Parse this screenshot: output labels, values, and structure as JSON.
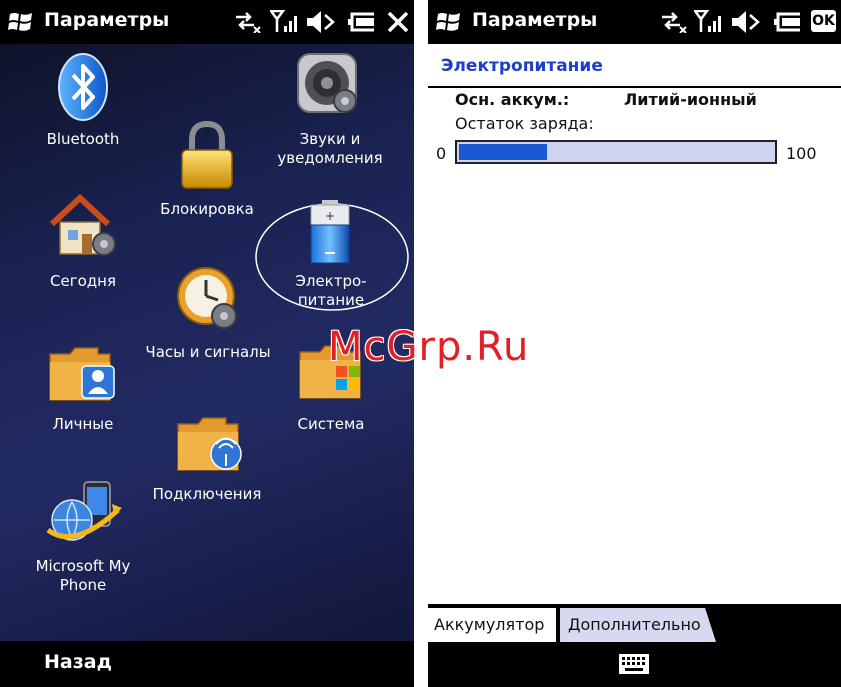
{
  "left": {
    "title": "Параметры",
    "tiles": {
      "bluetooth": "Bluetooth",
      "sounds": "Звуки и\nуведомления",
      "lock": "Блокировка",
      "today": "Сегодня",
      "power": "Электро-\nпитание",
      "clock": "Часы и сигналы",
      "personal": "Личные",
      "system": "Система",
      "connections": "Подключения",
      "myphone": "Microsoft My\nPhone"
    },
    "back_label": "Назад"
  },
  "right": {
    "title": "Параметры",
    "ok_label": "OK",
    "heading": "Электропитание",
    "battery_label": "Осн. аккум.:",
    "battery_type": "Литий-ионный",
    "charge_label": "Остаток заряда:",
    "progress_min": "0",
    "progress_max": "100",
    "progress_value": 28,
    "tabs": {
      "active": "Аккумулятор",
      "inactive": "Дополнительно"
    }
  },
  "watermark": "McGrp.Ru",
  "colors": {
    "heading_blue": "#1f3fc8",
    "progress_fill": "#1b59d3",
    "progress_track": "#cfd3ef",
    "watermark_red": "#e31e24"
  }
}
